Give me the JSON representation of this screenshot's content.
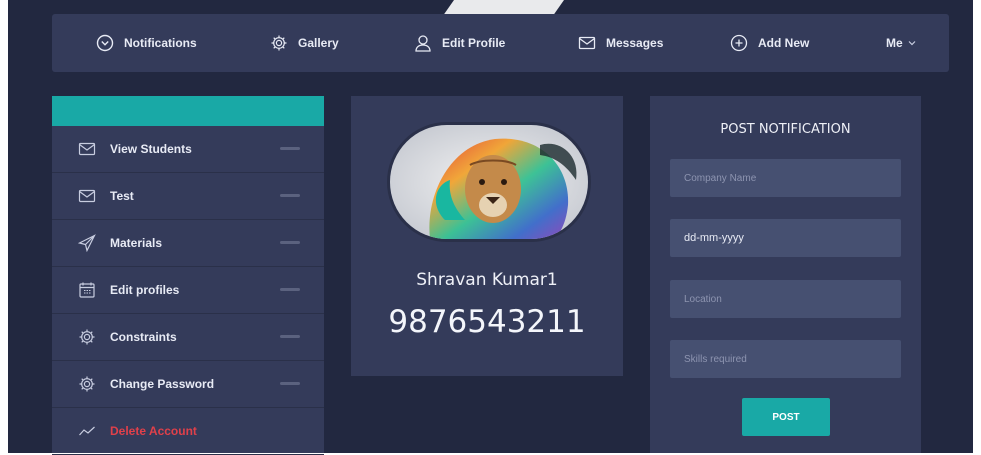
{
  "nav": {
    "notifications": "Notifications",
    "gallery": "Gallery",
    "edit_profile": "Edit Profile",
    "messages": "Messages",
    "add_new": "Add New",
    "me": "Me"
  },
  "sidebar": {
    "items": [
      {
        "label": "View Students",
        "icon": "envelope-icon"
      },
      {
        "label": "Test",
        "icon": "envelope-icon"
      },
      {
        "label": "Materials",
        "icon": "send-icon"
      },
      {
        "label": "Edit profiles",
        "icon": "calendar-icon"
      },
      {
        "label": "Constraints",
        "icon": "gear-icon"
      },
      {
        "label": "Change Password",
        "icon": "gear-icon"
      },
      {
        "label": "Delete Account",
        "icon": "trend-icon"
      }
    ]
  },
  "profile": {
    "name": "Shravan Kumar1",
    "phone": "9876543211"
  },
  "post": {
    "title": "POST NOTIFICATION",
    "company_placeholder": "Company Name",
    "date_value": "dd-mm-yyyy",
    "location_placeholder": "Location",
    "skills_placeholder": "Skills required",
    "button_label": "POST"
  },
  "colors": {
    "accent": "#19a9a6",
    "background": "#222840",
    "panel": "#343b5a",
    "danger": "#e0404a"
  }
}
